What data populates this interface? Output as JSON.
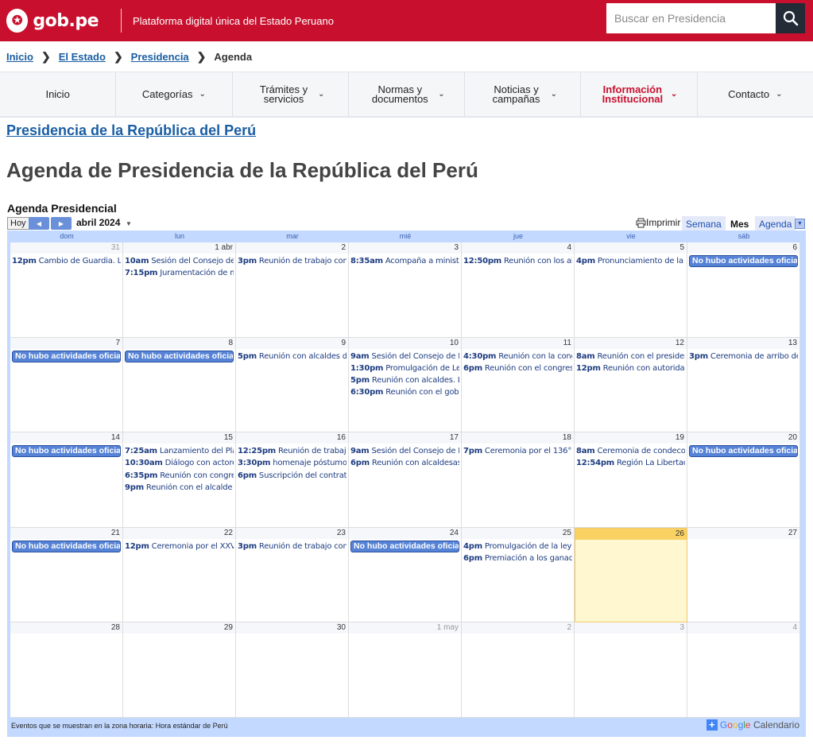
{
  "header": {
    "logo_text": "gob.pe",
    "tagline": "Plataforma digital única del Estado Peruano",
    "search_placeholder": "Buscar en Presidencia"
  },
  "breadcrumb": {
    "items": [
      "Inicio",
      "El Estado",
      "Presidencia"
    ],
    "current": "Agenda"
  },
  "nav": {
    "items": [
      {
        "label": "Inicio"
      },
      {
        "label": "Categorías"
      },
      {
        "label": "Trámites y servicios"
      },
      {
        "label": "Normas y documentos"
      },
      {
        "label": "Noticias y campañas"
      },
      {
        "label": "Información Institucional"
      },
      {
        "label": "Contacto"
      }
    ]
  },
  "main": {
    "presidencia_link": "Presidencia de la República del Perú",
    "page_title": "Agenda de Presidencia de la República del Perú"
  },
  "calendar": {
    "title": "Agenda Presidencial",
    "today_label": "Hoy",
    "month_label": "abril 2024",
    "print_label": "Imprimir",
    "views": [
      "Semana",
      "Mes",
      "Agenda"
    ],
    "selected_view": "Mes",
    "day_names": [
      "dom",
      "lun",
      "mar",
      "mié",
      "jue",
      "vie",
      "sáb"
    ],
    "footer_text": "Eventos que se muestran en la zona horaria: Hora estándar de Perú",
    "google_word": "Google",
    "calendario_word": "Calendario",
    "weeks": [
      [
        {
          "d": "31",
          "other": true,
          "events": [
            {
              "t": "12pm",
              "s": "Cambio de Guardia. Lu"
            }
          ]
        },
        {
          "d": "1 abr",
          "events": [
            {
              "t": "10am",
              "s": "Sesión del Consejo de"
            },
            {
              "t": "7:15pm",
              "s": "Juramentación de mi"
            }
          ]
        },
        {
          "d": "2",
          "events": [
            {
              "t": "3pm",
              "s": "Reunión de trabajo con"
            }
          ]
        },
        {
          "d": "3",
          "events": [
            {
              "t": "8:35am",
              "s": "Acompaña a ministro"
            }
          ]
        },
        {
          "d": "4",
          "events": [
            {
              "t": "12:50pm",
              "s": "Reunión con los alca"
            }
          ]
        },
        {
          "d": "5",
          "events": [
            {
              "t": "4pm",
              "s": "Pronunciamiento de la p"
            }
          ]
        },
        {
          "d": "6",
          "events": [
            {
              "allday": true,
              "s": "No hubo actividades oficiale"
            }
          ]
        }
      ],
      [
        {
          "d": "7",
          "events": [
            {
              "allday": true,
              "s": "No hubo actividades oficiale"
            }
          ]
        },
        {
          "d": "8",
          "events": [
            {
              "allday": true,
              "s": "No hubo actividades oficiale"
            }
          ]
        },
        {
          "d": "9",
          "events": [
            {
              "t": "5pm",
              "s": "Reunión con alcaldes de"
            }
          ]
        },
        {
          "d": "10",
          "events": [
            {
              "t": "9am",
              "s": "Sesión del Consejo de M"
            },
            {
              "t": "1:30pm",
              "s": "Promulgación de Ley"
            },
            {
              "t": "5pm",
              "s": "Reunión con alcaldes. L"
            },
            {
              "t": "6:30pm",
              "s": "Reunión con el gober"
            }
          ]
        },
        {
          "d": "11",
          "events": [
            {
              "t": "4:30pm",
              "s": "Reunión con la congr"
            },
            {
              "t": "6pm",
              "s": "Reunión con el congresi"
            }
          ]
        },
        {
          "d": "12",
          "events": [
            {
              "t": "8am",
              "s": "Reunión con el presiden"
            },
            {
              "t": "12pm",
              "s": "Reunión con autoridad"
            }
          ]
        },
        {
          "d": "13",
          "events": [
            {
              "t": "3pm",
              "s": "Ceremonia de arribo de"
            }
          ]
        }
      ],
      [
        {
          "d": "14",
          "events": [
            {
              "allday": true,
              "s": "No hubo actividades oficiale"
            }
          ]
        },
        {
          "d": "15",
          "events": [
            {
              "t": "7:25am",
              "s": "Lanzamiento del Plan"
            },
            {
              "t": "10:30am",
              "s": "Diálogo con actores"
            },
            {
              "t": "6:35pm",
              "s": "Reunión con congres"
            },
            {
              "t": "9pm",
              "s": "Reunión con el alcalde d"
            }
          ]
        },
        {
          "d": "16",
          "events": [
            {
              "t": "12:25pm",
              "s": "Reunión de trabajo c"
            },
            {
              "t": "3:30pm",
              "s": "homenaje póstumo a"
            },
            {
              "t": "6pm",
              "s": "Suscripción del contrato"
            }
          ]
        },
        {
          "d": "17",
          "events": [
            {
              "t": "9am",
              "s": "Sesión del Consejo de M"
            },
            {
              "t": "6pm",
              "s": "Reunión con alcaldesas"
            }
          ]
        },
        {
          "d": "18",
          "events": [
            {
              "t": "7pm",
              "s": "Ceremonia por el 136°"
            }
          ]
        },
        {
          "d": "19",
          "events": [
            {
              "t": "8am",
              "s": "Ceremonia de condecor"
            },
            {
              "t": "12:54pm",
              "s": "Región La Libertad:"
            }
          ]
        },
        {
          "d": "20",
          "events": [
            {
              "allday": true,
              "s": "No hubo actividades oficiale"
            }
          ]
        }
      ],
      [
        {
          "d": "21",
          "events": [
            {
              "allday": true,
              "s": "No hubo actividades oficiale"
            }
          ]
        },
        {
          "d": "22",
          "events": [
            {
              "t": "12pm",
              "s": "Ceremonia por el XXVI"
            }
          ]
        },
        {
          "d": "23",
          "events": [
            {
              "t": "3pm",
              "s": "Reunión de trabajo con"
            }
          ]
        },
        {
          "d": "24",
          "events": [
            {
              "allday": true,
              "s": "No hubo actividades oficiale"
            }
          ]
        },
        {
          "d": "25",
          "events": [
            {
              "t": "4pm",
              "s": "Promulgación de la ley d"
            },
            {
              "t": "6pm",
              "s": "Premiación a los ganado"
            }
          ]
        },
        {
          "d": "26",
          "today": true,
          "events": []
        },
        {
          "d": "27",
          "events": []
        }
      ],
      [
        {
          "d": "28",
          "events": []
        },
        {
          "d": "29",
          "events": []
        },
        {
          "d": "30",
          "events": []
        },
        {
          "d": "1 may",
          "other": true,
          "events": []
        },
        {
          "d": "2",
          "other": true,
          "events": []
        },
        {
          "d": "3",
          "other": true,
          "events": []
        },
        {
          "d": "4",
          "other": true,
          "events": []
        }
      ]
    ]
  }
}
